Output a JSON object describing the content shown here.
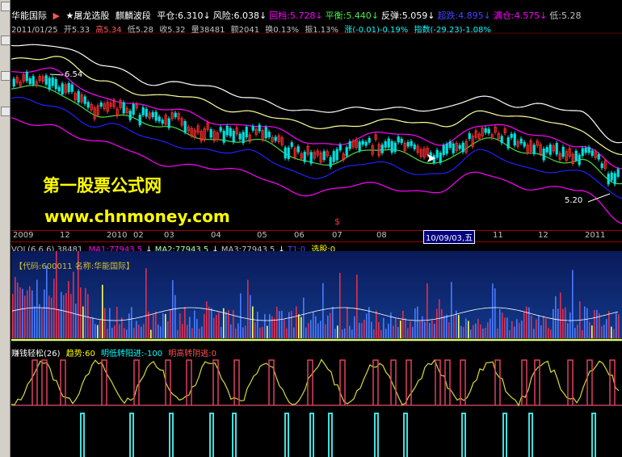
{
  "header": {
    "stock_name": "华能国际",
    "flag_icon": "red-flag-icon",
    "formula_name": "★屠龙选股",
    "formula_sub": "麒麟波段",
    "items": [
      {
        "label": "平仓:",
        "value": "6.310",
        "arrow": "↓",
        "color": "#ffffff"
      },
      {
        "label": "风险:",
        "value": "6.038",
        "arrow": "↓",
        "color": "#ffffff"
      },
      {
        "label": "回档:",
        "value": "5.728",
        "arrow": "↓",
        "color": "#ff00ff"
      },
      {
        "label": "平衡:",
        "value": "5.440",
        "arrow": "↓",
        "color": "#44ee44"
      },
      {
        "label": "反弹:",
        "value": "5.059",
        "arrow": "↓",
        "color": "#ffffff"
      },
      {
        "label": "超跌:",
        "value": "4.895",
        "arrow": "↓",
        "color": "#4444ff"
      },
      {
        "label": "满仓:",
        "value": "4.575",
        "arrow": "↓",
        "color": "#ff00ff"
      },
      {
        "label": "低:",
        "value": "5.28",
        "arrow": "",
        "color": "#c0c0c0"
      }
    ]
  },
  "quote": {
    "date": "2011/01/25",
    "open": "开5.33",
    "high": "高5.34",
    "low": "低5.28",
    "close": "收5.32",
    "volume": "量38481",
    "amount": "额2041",
    "turnover": "换0.13%",
    "amplitude": "振1.13%",
    "change": "涨(-0.01)-0.19%",
    "index": "指数(-29.23)-1.08%"
  },
  "price_chart": {
    "high_label": "6.54",
    "low_label": "5.20",
    "watermark_cn": "第一股票公式网",
    "watermark_url": "www.chnmoney.com",
    "dollar_marker": "$"
  },
  "date_axis": {
    "labels": [
      "2009",
      "12",
      "2010",
      "02",
      "03",
      "04",
      "05",
      "06",
      "07",
      "08",
      "11",
      "12",
      "2011"
    ],
    "cursor": "10/09/03,五"
  },
  "volume_panel": {
    "vol_label": "VOL(6,6,6)",
    "vol_value": "38481",
    "ma1": "MA1:77943.5",
    "ma2": "MA2:77943.5",
    "ma3": "MA3:77943.5",
    "t1": "T1:0",
    "select": "选股:0",
    "code_info": "【代码:600011 名称:华能国际】"
  },
  "indicator_panel": {
    "name": "赚钱轻松(26)",
    "trend": "趋势:60",
    "low_turn": "明低转阳进:-100",
    "high_turn": "明高转阴逃:0"
  },
  "colors": {
    "band_white": "#ffffff",
    "band_yellow": "#ffff99",
    "band_magenta": "#ff00ff",
    "band_green": "#44dd44",
    "band_blue": "#2020ff",
    "candle_up": "#ff3030",
    "candle_down": "#00e0e0",
    "vol_bar": "#4a7aff",
    "vol_highlight": "#ffff55",
    "ind_yellow": "#d8d83a",
    "ind_red": "#e04060",
    "ind_cyan": "#40e0e0"
  }
}
